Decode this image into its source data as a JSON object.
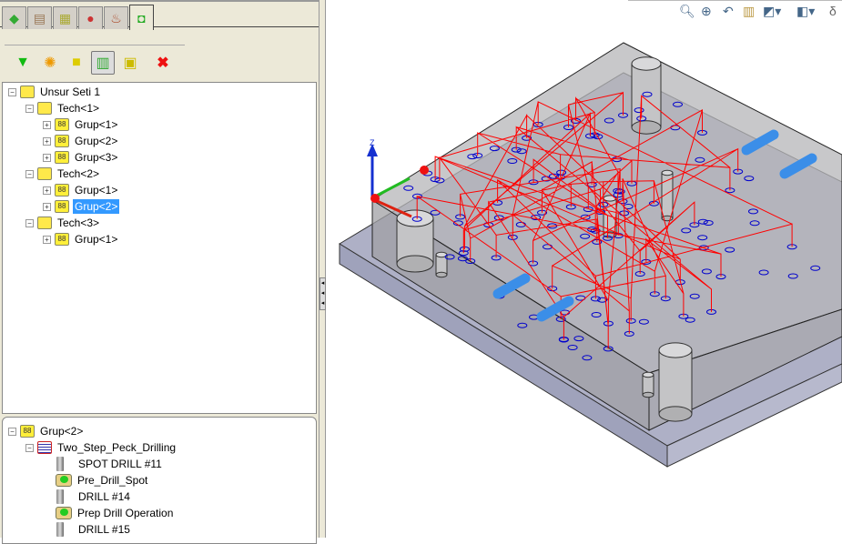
{
  "tabs": [
    {
      "icon": "feature-manager-icon"
    },
    {
      "icon": "property-manager-icon"
    },
    {
      "icon": "configuration-manager-icon"
    },
    {
      "icon": "appearance-icon"
    },
    {
      "icon": "cam-setup-icon"
    },
    {
      "icon": "cam-operation-tree-icon",
      "active": true
    }
  ],
  "toolbar": [
    {
      "icon": "machine-icon"
    },
    {
      "icon": "technology-icon"
    },
    {
      "icon": "feature-set-icon"
    },
    {
      "icon": "tool-operation-icon",
      "pressed": true
    },
    {
      "icon": "group-icon"
    },
    {
      "icon": "delete-icon"
    }
  ],
  "tree": {
    "root": "Unsur Seti 1",
    "techs": [
      {
        "label": "Tech<1>",
        "groups": [
          "Grup<1>",
          "Grup<2>",
          "Grup<3>"
        ]
      },
      {
        "label": "Tech<2>",
        "groups": [
          "Grup<1>",
          "Grup<2>"
        ]
      },
      {
        "label": "Tech<3>",
        "groups": [
          "Grup<1>"
        ]
      }
    ],
    "selected": "Tech<2>/Grup<2>"
  },
  "detail": {
    "group": "Grup<2>",
    "strategy": "Two_Step_Peck_Drilling",
    "items": [
      {
        "type": "tool",
        "label": "SPOT DRILL #11"
      },
      {
        "type": "operation",
        "label": "Pre_Drill_Spot"
      },
      {
        "type": "tool",
        "label": "DRILL #14"
      },
      {
        "type": "operation",
        "label": "Prep Drill Operation"
      },
      {
        "type": "tool",
        "label": "DRILL #15"
      }
    ]
  },
  "viewport": {
    "toolbar": [
      "zoom-to-fit-icon",
      "zoom-area-icon",
      "previous-view-icon",
      "section-view-icon",
      "view-orientation-icon",
      "display-style-icon",
      "hide-show-icon"
    ],
    "axis": {
      "z_label": "Z"
    },
    "colors": {
      "toolpath": "#ff0000",
      "holes": "#0000cc",
      "part": "#a9a9ad",
      "plate": "#a8abc4",
      "pins": "#3b8ee8"
    }
  }
}
